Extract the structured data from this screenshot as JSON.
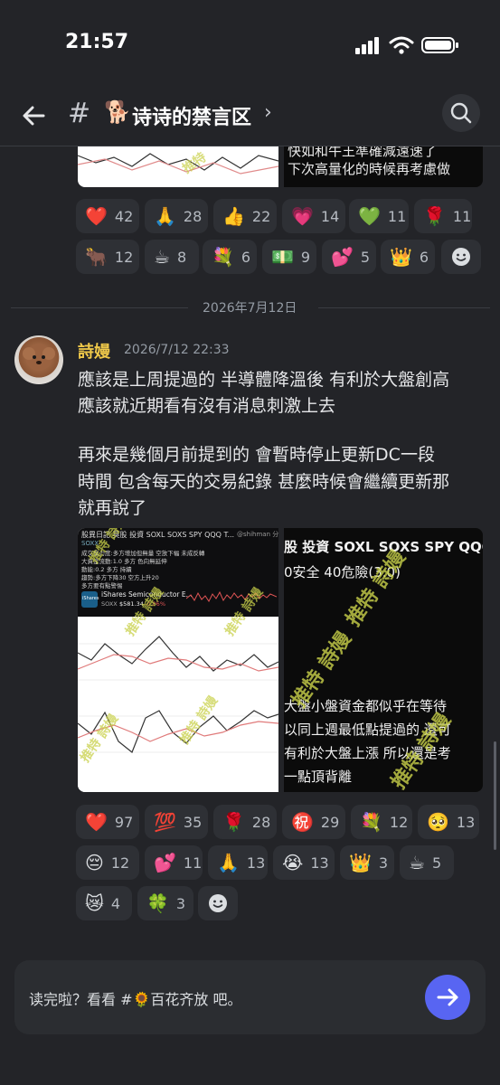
{
  "status": {
    "time": "21:57"
  },
  "header": {
    "channel_emoji": "🐕",
    "channel_name": "诗诗的禁言区",
    "hash": "#",
    "chevron": "›"
  },
  "prev_message": {
    "image_text_line1": "快如和牛王準確減遠速了",
    "image_text_line2": "下次高量化的時候再考慮做",
    "reactions": [
      {
        "emoji": "❤️",
        "count": "42"
      },
      {
        "emoji": "🙏",
        "count": "28"
      },
      {
        "emoji": "👍",
        "count": "22"
      },
      {
        "emoji": "💗",
        "count": "14"
      },
      {
        "emoji": "💚",
        "count": "11"
      },
      {
        "emoji": "🌹",
        "count": "11"
      },
      {
        "emoji": "🐂",
        "count": "12"
      },
      {
        "emoji": "☕",
        "count": "8"
      },
      {
        "emoji": "💐",
        "count": "6"
      },
      {
        "emoji": "💵",
        "count": "9"
      },
      {
        "emoji": "💕",
        "count": "5"
      },
      {
        "emoji": "👑",
        "count": "6"
      }
    ]
  },
  "date_divider": "2026年7月12日",
  "message": {
    "author": "詩嫚",
    "timestamp": "2026/7/12 22:33",
    "lines": [
      "應該是上周提過的 半導體降溫後 有利於大盤創高",
      "應該就近期看有沒有消息刺激上去",
      "再來是幾個月前提到的 會暫時停止更新DC一段",
      "時間 包含每天的交易紀錄 甚麼時候會繼續更新那",
      "就再說了"
    ],
    "image_left": {
      "title": "股異日記 莫股 投資 SOXL SOXS SPY QQQ T...",
      "channel": "@shihman 分鐘",
      "ticker": "SOXX",
      "notes": [
        "成交量力度:多方增加但無量 空放下幅 未成反轉",
        "大資金流動:1.0 多方 色向無延伸",
        "動能:0.2 多方 持續",
        "趨勢:多方下降30 空方上升20",
        "多方要有點警惕"
      ],
      "ishares_label": "iShares",
      "fund_name": "iShares Semiconductor E...",
      "fund_code": "SOXX",
      "fund_price": "$581.34",
      "fund_change": "-0.06%",
      "watermark": "推特 詩嫚"
    },
    "image_right": {
      "top_line1": "股 投資 SOXL SOXS SPY QQQ",
      "top_line2": "0安全 40危險(3.0)",
      "bottom_lines": [
        "大盤小盤資金都似乎在等待",
        "以同上週最低點提過的 還可",
        "有利於大盤上漲 所以還是考",
        "一點頂背離"
      ],
      "watermark": "推特 詩嫚"
    },
    "reactions": [
      {
        "emoji": "❤️",
        "count": "97"
      },
      {
        "emoji": "💯",
        "count": "35"
      },
      {
        "emoji": "🌹",
        "count": "28"
      },
      {
        "emoji": "㊗️",
        "count": "29"
      },
      {
        "emoji": "💐",
        "count": "12"
      },
      {
        "emoji": "🥺",
        "count": "13"
      },
      {
        "emoji": "😔",
        "count": "12"
      },
      {
        "emoji": "💕",
        "count": "11"
      },
      {
        "emoji": "🙏",
        "count": "13"
      },
      {
        "emoji": "😭",
        "count": "13"
      },
      {
        "emoji": "👑",
        "count": "3"
      },
      {
        "emoji": "☕",
        "count": "5"
      },
      {
        "emoji": "😿",
        "count": "4"
      },
      {
        "emoji": "🍀",
        "count": "3"
      }
    ]
  },
  "composer": {
    "text": "读完啦？看看 #🌻百花齐放 吧。"
  },
  "icons": [
    "back-arrow-icon",
    "search-icon",
    "add-reaction-icon",
    "send-arrow-icon",
    "signal-icon",
    "wifi-icon",
    "battery-icon"
  ],
  "colors": {
    "background": "#232428",
    "author": "#f0c94a",
    "send_button": "#5865f2",
    "chip": "#2e3035"
  }
}
